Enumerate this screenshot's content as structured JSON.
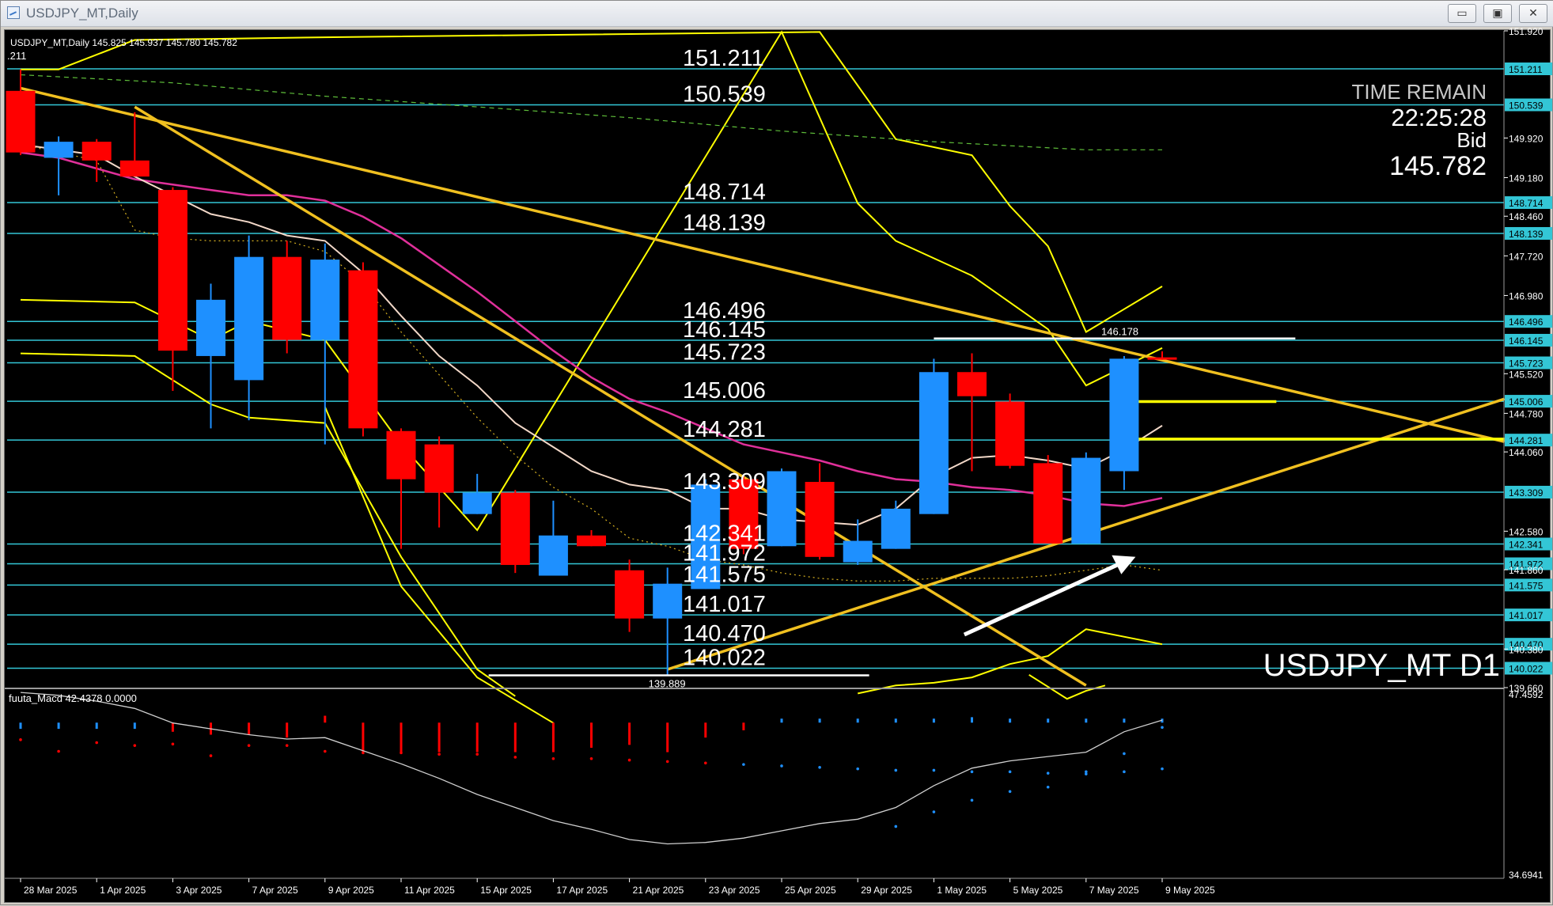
{
  "window": {
    "title": "USDJPY_MT,Daily",
    "buttons": {
      "minimize": "▭",
      "restore": "▣",
      "close": "✕"
    }
  },
  "header": {
    "info": "USDJPY_MT,Daily  145.825 145.937 145.780 145.782",
    "prev_fragment": ".211"
  },
  "info_panel": {
    "time_remain_label": "TIME REMAIN",
    "time_remain_value": "22:25:28",
    "bid_label": "Bid",
    "bid_value": "145.782"
  },
  "watermark": "USDJPY_MT D1",
  "macd_label": "fuuta_Macd 42.4378 0.0000",
  "colors": {
    "background": "#000000",
    "bull": "#1e90ff",
    "bear": "#ff0000",
    "level_line": "#33c6d6",
    "trend": "#f0c020",
    "band": "#ffff00",
    "ma_pink": "#e0309a",
    "ma_white": "#f2d8c8",
    "ma_dotted": "#d6b020",
    "ma_green_dashed": "#5fbf3a",
    "axis_text": "#ffffff",
    "price_tag_bg": "#33c6d6",
    "price_tag_text": "#000000"
  },
  "chart_data": {
    "type": "candlestick",
    "symbol": "USDJPY_MT",
    "timeframe": "D1",
    "ylim": [
      139.66,
      151.92
    ],
    "price_ticks": [
      "151.920",
      "149.920",
      "149.180",
      "148.460",
      "147.720",
      "146.980",
      "145.520",
      "144.780",
      "144.060",
      "142.580",
      "141.860",
      "140.380",
      "139.660"
    ],
    "date_labels": [
      "28 Mar 2025",
      "1 Apr 2025",
      "3 Apr 2025",
      "7 Apr 2025",
      "9 Apr 2025",
      "11 Apr 2025",
      "15 Apr 2025",
      "17 Apr 2025",
      "21 Apr 2025",
      "23 Apr 2025",
      "25 Apr 2025",
      "29 Apr 2025",
      "1 May 2025",
      "5 May 2025",
      "7 May 2025",
      "9 May 2025"
    ],
    "date_label_bar_index": [
      0,
      2,
      4,
      6,
      8,
      10,
      12,
      14,
      16,
      18,
      20,
      22,
      24,
      26,
      28,
      30
    ],
    "candles": [
      {
        "o": 150.8,
        "h": 151.2,
        "l": 149.6,
        "c": 149.65
      },
      {
        "o": 149.55,
        "h": 149.95,
        "l": 148.85,
        "c": 149.85
      },
      {
        "o": 149.85,
        "h": 149.9,
        "l": 149.1,
        "c": 149.5
      },
      {
        "o": 149.5,
        "h": 150.4,
        "l": 149.2,
        "c": 149.2
      },
      {
        "o": 148.95,
        "h": 149.0,
        "l": 145.2,
        "c": 145.95
      },
      {
        "o": 145.85,
        "h": 147.2,
        "l": 144.5,
        "c": 146.9
      },
      {
        "o": 145.4,
        "h": 148.1,
        "l": 144.65,
        "c": 147.7
      },
      {
        "o": 147.7,
        "h": 148.0,
        "l": 145.9,
        "c": 146.15
      },
      {
        "o": 146.15,
        "h": 147.95,
        "l": 144.2,
        "c": 147.65
      },
      {
        "o": 147.45,
        "h": 147.6,
        "l": 144.35,
        "c": 144.5
      },
      {
        "o": 144.45,
        "h": 144.5,
        "l": 142.25,
        "c": 143.55
      },
      {
        "o": 144.2,
        "h": 144.35,
        "l": 142.65,
        "c": 143.3
      },
      {
        "o": 142.9,
        "h": 143.65,
        "l": 142.9,
        "c": 143.3
      },
      {
        "o": 143.3,
        "h": 143.35,
        "l": 141.8,
        "c": 141.95
      },
      {
        "o": 141.75,
        "h": 143.15,
        "l": 141.75,
        "c": 142.5
      },
      {
        "o": 142.5,
        "h": 142.6,
        "l": 142.3,
        "c": 142.3
      },
      {
        "o": 141.85,
        "h": 142.05,
        "l": 140.7,
        "c": 140.95
      },
      {
        "o": 140.95,
        "h": 141.9,
        "l": 139.889,
        "c": 141.6
      },
      {
        "o": 141.5,
        "h": 143.55,
        "l": 141.5,
        "c": 143.45
      },
      {
        "o": 143.55,
        "h": 143.6,
        "l": 142.15,
        "c": 142.25
      },
      {
        "o": 142.3,
        "h": 143.75,
        "l": 142.3,
        "c": 143.7
      },
      {
        "o": 143.5,
        "h": 143.85,
        "l": 142.05,
        "c": 142.1
      },
      {
        "o": 142.0,
        "h": 142.8,
        "l": 141.95,
        "c": 142.4
      },
      {
        "o": 142.25,
        "h": 143.15,
        "l": 142.25,
        "c": 143.0
      },
      {
        "o": 142.9,
        "h": 145.8,
        "l": 142.9,
        "c": 145.55
      },
      {
        "o": 145.55,
        "h": 145.9,
        "l": 143.7,
        "c": 145.1
      },
      {
        "o": 145.0,
        "h": 145.15,
        "l": 143.75,
        "c": 143.8
      },
      {
        "o": 143.85,
        "h": 144.0,
        "l": 142.35,
        "c": 142.35
      },
      {
        "o": 142.35,
        "h": 144.05,
        "l": 142.35,
        "c": 143.95
      },
      {
        "o": 143.7,
        "h": 145.85,
        "l": 143.35,
        "c": 145.8
      },
      {
        "o": 145.825,
        "h": 145.937,
        "l": 145.78,
        "c": 145.782
      }
    ],
    "levels": [
      {
        "price": 151.211,
        "label": "151.211"
      },
      {
        "price": 150.539,
        "label": "150.539"
      },
      {
        "price": 148.714,
        "label": "148.714"
      },
      {
        "price": 148.139,
        "label": "148.139"
      },
      {
        "price": 146.496,
        "label": "146.496"
      },
      {
        "price": 146.145,
        "label": "146.145"
      },
      {
        "price": 145.723,
        "label": "145.723"
      },
      {
        "price": 145.006,
        "label": "145.006"
      },
      {
        "price": 144.281,
        "label": "144.281"
      },
      {
        "price": 143.309,
        "label": "143.309"
      },
      {
        "price": 142.341,
        "label": "142.341"
      },
      {
        "price": 141.972,
        "label": "141.972"
      },
      {
        "price": 141.575,
        "label": "141.575"
      },
      {
        "price": 141.017,
        "label": "141.017"
      },
      {
        "price": 140.47,
        "label": "140.470"
      },
      {
        "price": 140.022,
        "label": "140.022"
      }
    ],
    "marked_prices": [
      {
        "price": 146.178,
        "label": "146.178"
      },
      {
        "price": 139.889,
        "label": "139.889"
      }
    ],
    "trendlines": [
      {
        "from": [
          0,
          150.85
        ],
        "to": [
          39,
          144.25
        ]
      },
      {
        "from": [
          3,
          150.5
        ],
        "to": [
          28,
          139.7
        ]
      },
      {
        "from": [
          17,
          140.0
        ],
        "to": [
          39,
          145.05
        ]
      }
    ],
    "horizontal_segments": [
      {
        "from_bar": 29,
        "to_bar": 33,
        "price": 145.0
      },
      {
        "from_bar": 29,
        "to_bar": 39,
        "price": 144.3
      }
    ],
    "arrow": {
      "from": [
        24.8,
        140.65
      ],
      "to": [
        29.3,
        142.1
      ]
    },
    "ma_white": [
      149.8,
      149.7,
      149.6,
      149.2,
      148.85,
      148.5,
      148.35,
      148.1,
      148.0,
      147.4,
      146.6,
      145.85,
      145.3,
      144.6,
      144.15,
      143.7,
      143.45,
      143.35,
      143.0,
      143.0,
      142.8,
      142.75,
      142.7,
      143.0,
      143.6,
      143.95,
      144.0,
      143.9,
      143.75,
      144.1,
      144.55
    ],
    "ma_pink": [
      149.65,
      149.55,
      149.35,
      149.15,
      149.05,
      148.95,
      148.85,
      148.85,
      148.75,
      148.45,
      148.05,
      147.55,
      147.05,
      146.5,
      145.95,
      145.45,
      145.05,
      144.8,
      144.5,
      144.2,
      144.05,
      143.9,
      143.7,
      143.55,
      143.5,
      143.4,
      143.35,
      143.25,
      143.1,
      143.05,
      143.2
    ],
    "ma_dotted": [
      149.8,
      149.65,
      149.5,
      148.2,
      148.05,
      148.0,
      148.0,
      148.0,
      147.8,
      147.2,
      146.3,
      145.5,
      144.7,
      144.0,
      143.4,
      143.0,
      142.45,
      142.3,
      142.05,
      141.95,
      141.8,
      141.7,
      141.65,
      141.65,
      141.7,
      141.7,
      141.7,
      141.75,
      141.85,
      141.95,
      141.85
    ],
    "ma_green": [
      {
        "bar": 0,
        "price": 151.1
      },
      {
        "bar": 4,
        "price": 150.95
      },
      {
        "bar": 8,
        "price": 150.7
      },
      {
        "bar": 12,
        "price": 150.5
      },
      {
        "bar": 16,
        "price": 150.3
      },
      {
        "bar": 20,
        "price": 150.05
      },
      {
        "bar": 24,
        "price": 149.85
      },
      {
        "bar": 28,
        "price": 149.7
      },
      {
        "bar": 30,
        "price": 149.7
      }
    ],
    "band_outer_upper": [
      {
        "bar": 0,
        "price": 151.2
      },
      {
        "bar": 1,
        "price": 151.2
      },
      {
        "bar": 3,
        "price": 151.75
      },
      {
        "bar": 8,
        "price": 151.8
      },
      {
        "bar": 21,
        "price": 151.9
      },
      {
        "bar": 23,
        "price": 149.9
      },
      {
        "bar": 25,
        "price": 149.6
      },
      {
        "bar": 26,
        "price": 148.65
      },
      {
        "bar": 27,
        "price": 147.9
      },
      {
        "bar": 28,
        "price": 146.3
      },
      {
        "bar": 30,
        "price": 147.15
      }
    ],
    "band_inner_upper": [
      {
        "bar": 0,
        "price": 146.9
      },
      {
        "bar": 3,
        "price": 146.85
      },
      {
        "bar": 5,
        "price": 146.15
      },
      {
        "bar": 6,
        "price": 146.5
      },
      {
        "bar": 8,
        "price": 146.15
      },
      {
        "bar": 10,
        "price": 144.2
      },
      {
        "bar": 12,
        "price": 142.6
      },
      {
        "bar": 20,
        "price": 151.9
      },
      {
        "bar": 22,
        "price": 148.7
      },
      {
        "bar": 23,
        "price": 148.0
      },
      {
        "bar": 25,
        "price": 147.35
      },
      {
        "bar": 27,
        "price": 146.35
      },
      {
        "bar": 28,
        "price": 145.3
      },
      {
        "bar": 30,
        "price": 146.0
      }
    ],
    "band_inner_lower": [
      {
        "bar": 0,
        "price": 145.9
      },
      {
        "bar": 3,
        "price": 145.85
      },
      {
        "bar": 5,
        "price": 144.95
      },
      {
        "bar": 6,
        "price": 144.7
      },
      {
        "bar": 8,
        "price": 144.6
      },
      {
        "bar": 10,
        "price": 142.1
      },
      {
        "bar": 12,
        "price": 140.0
      },
      {
        "bar": 13,
        "price": 139.5
      }
    ],
    "band_outer_lower": [
      {
        "bar": 8,
        "price": 144.9
      },
      {
        "bar": 10,
        "price": 141.55
      },
      {
        "bar": 12,
        "price": 139.85
      },
      {
        "bar": 14,
        "price": 139.0
      }
    ],
    "band_bottom": [
      {
        "bar": 22,
        "price": 139.55
      },
      {
        "bar": 23,
        "price": 139.7
      },
      {
        "bar": 24,
        "price": 139.75
      },
      {
        "bar": 25,
        "price": 139.85
      },
      {
        "bar": 26,
        "price": 140.1
      },
      {
        "bar": 27,
        "price": 140.25
      },
      {
        "bar": 28,
        "price": 140.75
      },
      {
        "bar": 30,
        "price": 140.47
      }
    ],
    "band_bottom_tail": [
      {
        "bar": 26.5,
        "price": 139.9
      },
      {
        "bar": 27.5,
        "price": 139.45
      },
      {
        "bar": 28,
        "price": 139.6
      },
      {
        "bar": 28.5,
        "price": 139.7
      }
    ],
    "macd": {
      "ylim": [
        34.6941,
        47.4592
      ],
      "top_label": "47.4592",
      "bottom_label": "34.6941",
      "histogram": [
        44.9,
        44.9,
        44.9,
        44.9,
        44.7,
        44.5,
        44.5,
        44.3,
        45.8,
        43.3,
        43.3,
        43.3,
        43.3,
        43.3,
        43.3,
        43.6,
        43.8,
        43.3,
        44.3,
        44.8,
        45.0,
        45.0,
        45.0,
        45.0,
        45.6,
        45.7,
        45.6,
        45.2,
        45.0,
        45.4,
        45.6
      ],
      "signal_dots": [
        46.6,
        45.8,
        46.4,
        46.2,
        46.3,
        45.5,
        46.2,
        46.2,
        45.8,
        45.7,
        45.7,
        45.6,
        45.6,
        45.4,
        45.3,
        45.3,
        45.2,
        45.1,
        45.0,
        44.9,
        44.8,
        44.7,
        44.6,
        44.5,
        44.5,
        44.4,
        44.4,
        44.3,
        44.4,
        44.4,
        44.6
      ],
      "signal_colors": [
        "bear",
        "bear",
        "bear",
        "bear",
        "bear",
        "bear",
        "bear",
        "bear",
        "bear",
        "bear",
        "bear",
        "bear",
        "bear",
        "bear",
        "bear",
        "bear",
        "bear",
        "bear",
        "bear",
        "bull",
        "bull",
        "bull",
        "bull",
        "bull",
        "bull",
        "bull",
        "bull",
        "bull",
        "bull",
        "bull",
        "bull"
      ],
      "hist_colors": [
        "bull",
        "bull",
        "bull",
        "bull",
        "bear",
        "bear",
        "bear",
        "bear",
        "bear",
        "bear",
        "bear",
        "bear",
        "bear",
        "bear",
        "bear",
        "bear",
        "bear",
        "bear",
        "bear",
        "bear",
        "bull",
        "bull",
        "bull",
        "bull",
        "bull",
        "bull",
        "bull",
        "bull",
        "bull",
        "bull",
        "bull"
      ],
      "line": [
        47.4,
        47.2,
        46.8,
        46.3,
        45.3,
        44.9,
        44.5,
        44.2,
        44.3,
        43.4,
        42.5,
        41.5,
        40.4,
        39.5,
        38.6,
        38.0,
        37.3,
        37.0,
        37.1,
        37.4,
        37.9,
        38.4,
        38.7,
        39.5,
        41.0,
        42.2,
        42.7,
        43.0,
        43.3,
        44.7,
        45.5
      ],
      "dots_extra": [
        {
          "bar": 24,
          "value": 38.2
        },
        {
          "bar": 25,
          "value": 39.2
        },
        {
          "bar": 26,
          "value": 40.0
        },
        {
          "bar": 27,
          "value": 40.6
        },
        {
          "bar": 28,
          "value": 40.9
        },
        {
          "bar": 29,
          "value": 41.8
        },
        {
          "bar": 30,
          "value": 43.2
        },
        {
          "bar": 31,
          "value": 45.0
        }
      ]
    }
  }
}
